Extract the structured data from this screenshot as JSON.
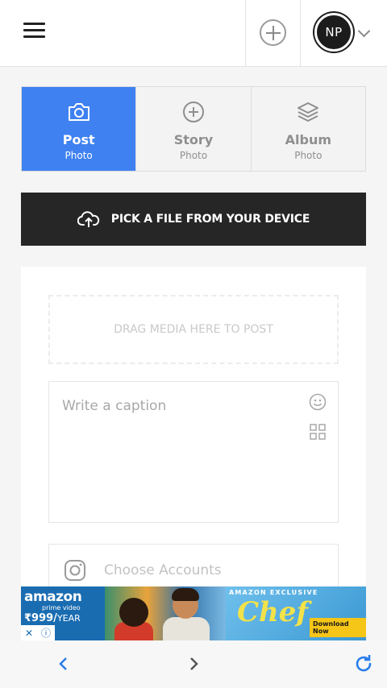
{
  "header": {
    "menu_icon": "hamburger-icon",
    "add_icon": "plus-circle-icon",
    "avatar_initials": "NP",
    "dropdown_icon": "chevron-down-icon"
  },
  "tabs": [
    {
      "label": "Post",
      "sub": "Photo",
      "icon": "camera-icon",
      "active": true
    },
    {
      "label": "Story",
      "sub": "Photo",
      "icon": "plus-circle-icon",
      "active": false
    },
    {
      "label": "Album",
      "sub": "Photo",
      "icon": "layers-icon",
      "active": false
    }
  ],
  "upload": {
    "label": "PICK A FILE FROM YOUR DEVICE",
    "icon": "cloud-upload-icon"
  },
  "composer": {
    "dropzone_text": "DRAG MEDIA HERE TO POST",
    "caption_placeholder": "Write a caption",
    "emoji_icon": "smiley-icon",
    "grid_icon": "grid-icon",
    "accounts_placeholder": "Choose Accounts",
    "accounts_icon": "instagram-icon"
  },
  "ad": {
    "brand": "amazon",
    "brand_sub": "prime video",
    "price": "₹999/",
    "price_period": "YEAR",
    "exclusive": "AMAZON EXCLUSIVE",
    "title": "Chef",
    "cta": "Download Now",
    "close_icon": "close-icon",
    "info_icon": "info-icon"
  },
  "bottom_nav": {
    "back_icon": "chevron-left-icon",
    "forward_icon": "chevron-right-icon",
    "refresh_icon": "refresh-icon"
  },
  "colors": {
    "accent": "#3f81f1",
    "dark_button": "#262626",
    "nav_blue": "#2b7de9"
  }
}
